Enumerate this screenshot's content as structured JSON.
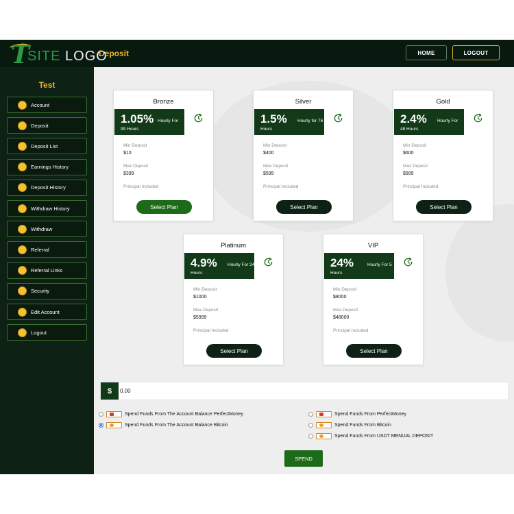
{
  "colors": {
    "dark": "#081a10",
    "sidebar": "#0d2114",
    "accent": "#f0b528",
    "green": "#1d6a18",
    "rate_box": "#123a18"
  },
  "logo": {
    "letter": "T",
    "site": "SITE",
    "word": "LOGO"
  },
  "header": {
    "page_title": "Deposit",
    "home_label": "HOME",
    "logout_label": "LOGOUT"
  },
  "sidebar": {
    "user": "Test",
    "items": [
      {
        "label": "Account",
        "icon": "coin-icon"
      },
      {
        "label": "Deposit",
        "icon": "coin-icon"
      },
      {
        "label": "Deposit List",
        "icon": "coin-icon"
      },
      {
        "label": "Earnings History",
        "icon": "coin-icon"
      },
      {
        "label": "Deposit History",
        "icon": "coin-icon"
      },
      {
        "label": "Withdraw History",
        "icon": "coin-icon"
      },
      {
        "label": "Withdraw",
        "icon": "coin-icon"
      },
      {
        "label": "Referral",
        "icon": "coin-icon"
      },
      {
        "label": "Referral Links",
        "icon": "coin-icon"
      },
      {
        "label": "Security",
        "icon": "coin-icon"
      },
      {
        "label": "Edit Account",
        "icon": "coin-icon"
      },
      {
        "label": "Logout",
        "icon": "coin-icon"
      }
    ]
  },
  "plans": [
    {
      "name": "Bronze",
      "rate": "1.05%",
      "hourly": "Hourly For",
      "hours": "99 Hours",
      "min_label": "Min Deposit",
      "min": "$10",
      "max_label": "Max Deposit",
      "max": "$399",
      "principal": "Principal Included",
      "button": "Select Plan"
    },
    {
      "name": "Silver",
      "rate": "1.5%",
      "hourly": "Hourly for 76",
      "hours": "Hours",
      "min_label": "Min Deposit",
      "min": "$400",
      "max_label": "Max Deposit",
      "max": "$599",
      "principal": "Principal Included",
      "button": "Select Plan"
    },
    {
      "name": "Gold",
      "rate": "2.4%",
      "hourly": "Hourly For",
      "hours": "48 Hours",
      "min_label": "Min Deposit",
      "min": "$600",
      "max_label": "Max Deposit",
      "max": "$999",
      "principal": "Principal Included",
      "button": "Select Plan"
    },
    {
      "name": "Platinum",
      "rate": "4.9%",
      "hourly": "Hourly For 24",
      "hours": "Hours",
      "min_label": "Min Deposit",
      "min": "$1000",
      "max_label": "Max Deposit",
      "max": "$5999",
      "principal": "Principal Included",
      "button": "Select Plan"
    },
    {
      "name": "VIP",
      "rate": "24%",
      "hourly": "Hourly For 5",
      "hours": "Hours",
      "min_label": "Min Deposit",
      "min": "$8000",
      "max_label": "Max Deposit",
      "max": "$48000",
      "principal": "Principal Included",
      "button": "Select Plan"
    }
  ],
  "amount": {
    "currency": "$",
    "value": "0.00"
  },
  "payment_options": [
    {
      "label": "Spend Funds From The Account Balance PerfectMoney",
      "icon": "perfectmoney-icon",
      "checked": false
    },
    {
      "label": "Spend Funds From The Account Balance Bitcoin",
      "icon": "bitcoin-icon",
      "checked": true
    },
    {
      "label": "Spend Funds From PerfectMoney",
      "icon": "perfectmoney-icon",
      "checked": false
    },
    {
      "label": "Spend Funds From Bitcoin",
      "icon": "bitcoin-icon",
      "checked": false
    },
    {
      "label": "Spend Funds From USDT MENUAL DEPOSIT",
      "icon": "usdt-icon",
      "checked": false
    }
  ],
  "spend_label": "SPEND"
}
